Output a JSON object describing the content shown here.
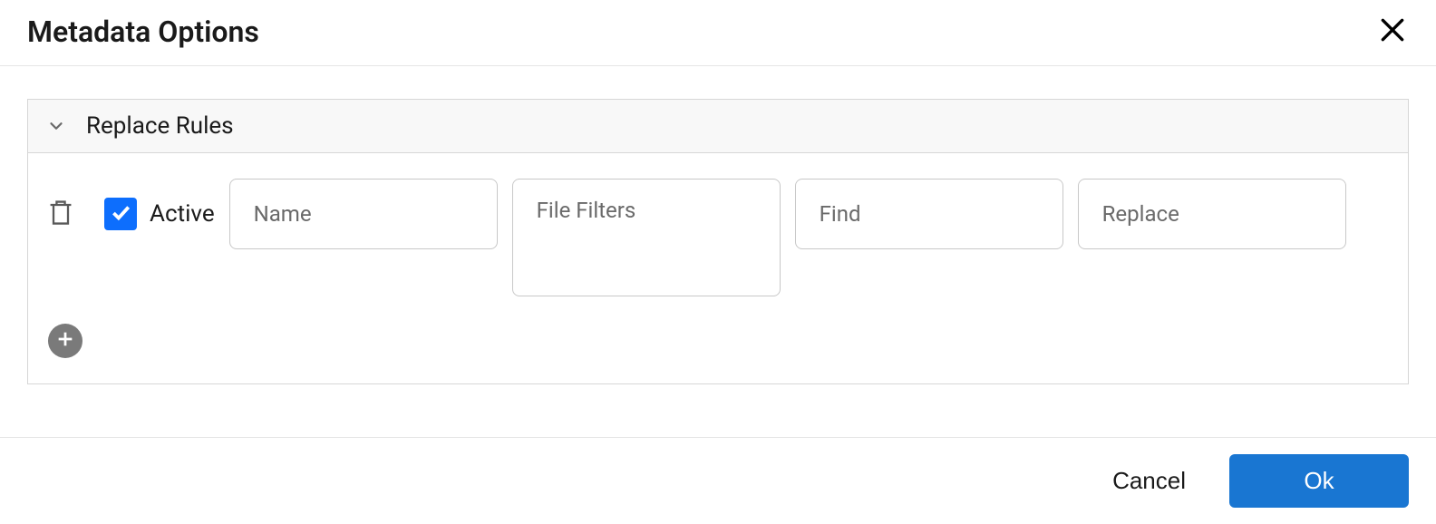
{
  "dialog": {
    "title": "Metadata Options"
  },
  "panel": {
    "title": "Replace Rules"
  },
  "rule": {
    "active_label": "Active",
    "active_checked": true,
    "name_placeholder": "Name",
    "name_value": "",
    "filters_placeholder": "File Filters",
    "filters_value": "",
    "find_placeholder": "Find",
    "find_value": "",
    "replace_placeholder": "Replace",
    "replace_value": ""
  },
  "footer": {
    "cancel_label": "Cancel",
    "ok_label": "Ok"
  },
  "colors": {
    "primary": "#1976d2",
    "checkbox": "#0d6efd",
    "border": "#d6d6d6"
  }
}
